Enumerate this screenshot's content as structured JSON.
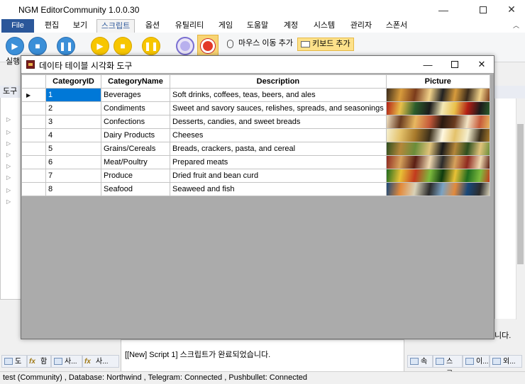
{
  "window": {
    "title": "NGM Editor",
    "edition": "Community 1.0.0.30"
  },
  "menu": {
    "file": "File",
    "items": [
      "편집",
      "보기",
      "스크립트",
      "옵션",
      "유틸리티",
      "게임",
      "도움말",
      "계정",
      "시스템",
      "관리자",
      "스폰서"
    ],
    "active_index": 2
  },
  "ribbon": {
    "run_label": "실행",
    "mouse_move_add": "마우스 이동 추가",
    "keyboard_add": "키보드 추가"
  },
  "left_panel": {
    "header": "도구"
  },
  "right_panel": {
    "note": "니다."
  },
  "dialog": {
    "title": "데이타 테이블 시각화 도구",
    "columns": [
      "CategoryID",
      "CategoryName",
      "Description",
      "Picture"
    ],
    "rows": [
      {
        "id": "1",
        "name": "Beverages",
        "description": "Soft drinks, coffees, teas, beers, and ales"
      },
      {
        "id": "2",
        "name": "Condiments",
        "description": "Sweet and savory sauces, relishes, spreads, and seasonings"
      },
      {
        "id": "3",
        "name": "Confections",
        "description": "Desserts, candies, and sweet breads"
      },
      {
        "id": "4",
        "name": "Dairy Products",
        "description": "Cheeses"
      },
      {
        "id": "5",
        "name": "Grains/Cereals",
        "description": "Breads, crackers, pasta, and cereal"
      },
      {
        "id": "6",
        "name": "Meat/Poultry",
        "description": "Prepared meats"
      },
      {
        "id": "7",
        "name": "Produce",
        "description": "Dried fruit and bean curd"
      },
      {
        "id": "8",
        "name": "Seafood",
        "description": "Seaweed and fish"
      }
    ],
    "selected_row": 0
  },
  "output": {
    "message": "[[New] Script 1] 스크립트가 완료되었습니다."
  },
  "bottom_tabs_left": [
    "도",
    "함",
    "사...",
    "사..."
  ],
  "bottom_tabs_right": [
    "속",
    "스크...",
    "이...",
    "외..."
  ],
  "status": {
    "text": "test (Community)  , Database: Northwind  , Telegram: Connected  , Pushbullet: Connected"
  },
  "colors": {
    "accent": "#2b579a",
    "selection": "#0078d7",
    "grid_background": "#ababab"
  }
}
